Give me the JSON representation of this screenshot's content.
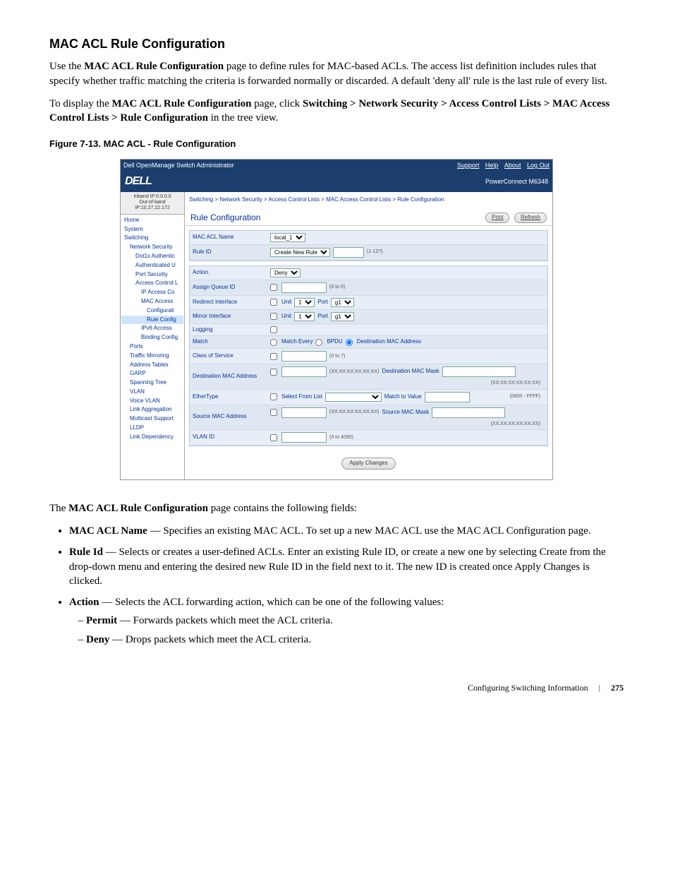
{
  "heading": "MAC ACL Rule Configuration",
  "intro1_pre": "Use the ",
  "intro1_bold": "MAC ACL Rule Configuration",
  "intro1_post": " page to define rules for MAC-based ACLs. The access list definition includes rules that specify whether traffic matching the criteria is forwarded normally or discarded. A default 'deny all' rule is the last rule of every list.",
  "intro2_pre": "To display the ",
  "intro2_bold": "MAC ACL Rule Configuration",
  "intro2_mid": " page, click ",
  "intro2_nav": "Switching > Network Security > Access Control Lists > MAC Access Control Lists > Rule Configuration",
  "intro2_post": " in the tree view.",
  "figure_caption": "Figure 7-13.    MAC ACL - Rule Configuration",
  "shot": {
    "top_title": "Dell OpenManage Switch Administrator",
    "top_links": [
      "Support",
      "Help",
      "About",
      "Log Out"
    ],
    "brand": "DELL",
    "brand_right": "PowerConnect M6348",
    "side_ip1": "Inband IP:0.0.0.0",
    "side_ip2": "Out-of-band IP:10.27.22.172",
    "tree": [
      {
        "lv": 1,
        "t": "Home"
      },
      {
        "lv": 1,
        "t": "System"
      },
      {
        "lv": 1,
        "t": "Switching"
      },
      {
        "lv": 2,
        "t": "Network Security"
      },
      {
        "lv": 3,
        "t": "Dot1x Authentic"
      },
      {
        "lv": 3,
        "t": "Authenticated U"
      },
      {
        "lv": 3,
        "t": "Port Security"
      },
      {
        "lv": 3,
        "t": "Access Control L"
      },
      {
        "lv": 4,
        "t": "IP Access Co"
      },
      {
        "lv": 4,
        "t": "MAC Access"
      },
      {
        "lv": 5,
        "t": "Configurati"
      },
      {
        "lv": 5,
        "t": "Rule Config",
        "sel": true
      },
      {
        "lv": 4,
        "t": "IPv6 Access"
      },
      {
        "lv": 4,
        "t": "Binding Config"
      },
      {
        "lv": 2,
        "t": "Ports"
      },
      {
        "lv": 2,
        "t": "Traffic Mirroring"
      },
      {
        "lv": 2,
        "t": "Address Tables"
      },
      {
        "lv": 2,
        "t": "GARP"
      },
      {
        "lv": 2,
        "t": "Spanning Tree"
      },
      {
        "lv": 2,
        "t": "VLAN"
      },
      {
        "lv": 2,
        "t": "Voice VLAN"
      },
      {
        "lv": 2,
        "t": "Link Aggregation"
      },
      {
        "lv": 2,
        "t": "Multicast Support"
      },
      {
        "lv": 2,
        "t": "LLDP"
      },
      {
        "lv": 2,
        "t": "Link Dependency"
      }
    ],
    "crumb": "Switching > Network Security > Access Control Lists > MAC Access Control Lists > Rule Configuration",
    "panel_title": "Rule Configuration",
    "btn_print": "Print",
    "btn_refresh": "Refresh",
    "rows": {
      "mac_acl_name": {
        "label": "MAC ACL Name",
        "value": "local_1"
      },
      "rule_id": {
        "label": "Rule ID",
        "value": "Create New Rule",
        "hint": "(1-127)"
      },
      "action": {
        "label": "Action",
        "value": "Deny"
      },
      "queue": {
        "label": "Assign Queue ID",
        "hint": "(0 to 6)"
      },
      "redirect": {
        "label": "Redirect Interface",
        "unit": "Unit",
        "unit_v": "1",
        "port": "Port",
        "port_v": "g1"
      },
      "mirror": {
        "label": "Mirror Interface",
        "unit": "Unit",
        "unit_v": "1",
        "port": "Port",
        "port_v": "g1"
      },
      "logging": {
        "label": "Logging"
      },
      "match": {
        "label": "Match",
        "o1": "Match Every",
        "o2": "BPDU",
        "o3": "Destination MAC Address"
      },
      "cos": {
        "label": "Class of Service",
        "hint": "(0 to 7)"
      },
      "dmac": {
        "label": "Destination MAC Address",
        "hint": "(XX:XX:XX:XX:XX:XX)",
        "mask": "Destination MAC Mask",
        "mhint": "(XX:XX:XX:XX:XX:XX)"
      },
      "etype": {
        "label": "EtherType",
        "sel": "Select From List",
        "mtv": "Match to Value",
        "hint": "(0600 - FFFF)"
      },
      "smac": {
        "label": "Source MAC Address",
        "hint": "(XX:XX:XX:XX:XX:XX)",
        "mask": "Source MAC Mask",
        "mhint": "(XX:XX:XX:XX:XX:XX)"
      },
      "vlan": {
        "label": "VLAN ID",
        "hint": "(0 to 4095)"
      }
    },
    "apply": "Apply Changes"
  },
  "fields_intro_pre": "The ",
  "fields_intro_bold": "MAC ACL Rule Configuration",
  "fields_intro_post": " page contains the following fields:",
  "fields": {
    "f1_b": "MAC ACL Name",
    "f1_t": " — Specifies an existing MAC ACL. To set up a new MAC ACL use the MAC ACL Configuration page.",
    "f2_b": "Rule Id",
    "f2_t": " — Selects or creates a user-defined ACLs. Enter an existing Rule ID, or create a new one by selecting Create from the drop-down menu and entering the desired new Rule ID in the field next to it. The new ID is created once Apply Changes is clicked.",
    "f3_b": "Action",
    "f3_t": " — Selects the ACL forwarding action, which can be one of the following values:",
    "f3a_b": "Permit",
    "f3a_t": " — Forwards packets which meet the ACL criteria.",
    "f3b_b": "Deny",
    "f3b_t": " — Drops packets which meet the ACL criteria."
  },
  "footer_text": "Configuring Switching Information",
  "footer_page": "275"
}
